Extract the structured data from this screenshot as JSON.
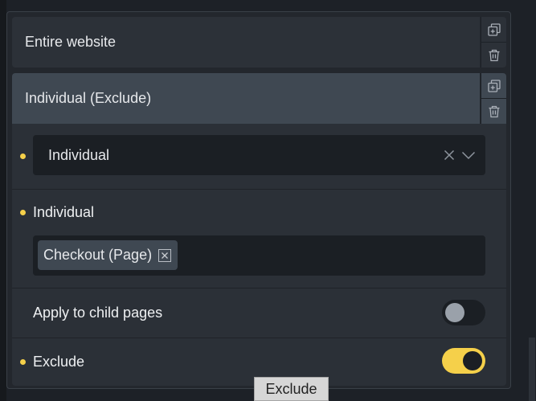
{
  "conditions": [
    {
      "label": "Entire website"
    },
    {
      "label": "Individual (Exclude)"
    }
  ],
  "condition_actions": {
    "duplicate_icon": "duplicate-icon",
    "delete_icon": "trash-icon"
  },
  "editor": {
    "type_select": {
      "value": "Individual",
      "clear_icon": "close-icon",
      "open_icon": "chevron-down-icon"
    },
    "individual": {
      "label": "Individual",
      "tags": [
        {
          "label": "Checkout (Page)"
        }
      ]
    },
    "apply_child_pages": {
      "label": "Apply to child pages",
      "enabled": false
    },
    "exclude": {
      "label": "Exclude",
      "enabled": true
    }
  },
  "tooltip": {
    "text": "Exclude"
  },
  "colors": {
    "accent": "#f5d04a",
    "panel": "#23272d",
    "row": "#2c3138",
    "row_active": "#3f4852",
    "input": "#1b1f24"
  }
}
